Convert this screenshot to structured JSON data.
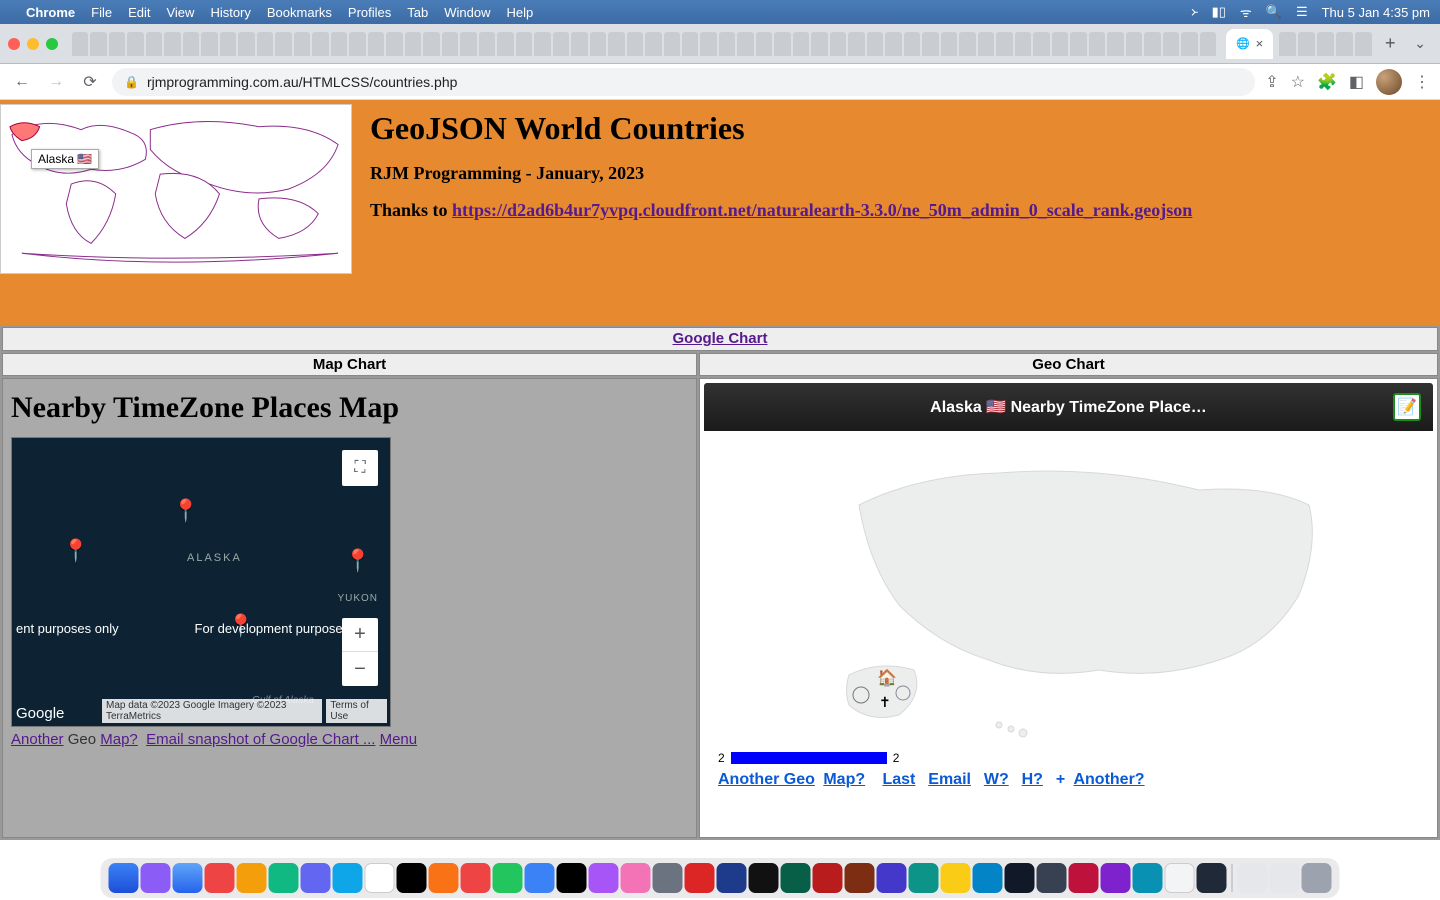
{
  "menubar": {
    "app": "Chrome",
    "items": [
      "File",
      "Edit",
      "View",
      "History",
      "Bookmarks",
      "Profiles",
      "Tab",
      "Window",
      "Help"
    ],
    "clock": "Thu 5 Jan  4:35 pm"
  },
  "browser": {
    "url": "rjmprogramming.com.au/HTMLCSS/countries.php",
    "active_tab_close": "×",
    "new_tab": "+"
  },
  "page": {
    "title": "GeoJSON World Countries",
    "subtitle": "RJM Programming - January, 2023",
    "thanks_prefix": "Thanks to ",
    "thanks_link": "https://d2ad6b4ur7yvpq.cloudfront.net/naturalearth-3.3.0/ne_50m_admin_0_scale_rank.geojson",
    "tooltip": "Alaska 🇺🇸"
  },
  "table": {
    "google_chart": "Google Chart",
    "map_chart": "Map Chart",
    "geo_chart": "Geo Chart"
  },
  "left": {
    "heading": "Nearby TimeZone Places Map",
    "alaska": "ALASKA",
    "yukon": "YUKON",
    "gulf": "Gulf of Alaska",
    "dev1": "ent purposes only",
    "dev2": "For development purposes o",
    "google": "Google",
    "attrib1": "Map data ©2023 Google Imagery ©2023 TerraMetrics",
    "attrib2": "Terms of Use",
    "links": {
      "another": "Another",
      "geo": "Geo",
      "mapq": "Map?",
      "email": "Email snapshot of Google Chart ...",
      "menu": "Menu"
    }
  },
  "right": {
    "header": "Alaska 🇺🇸 Nearby TimeZone Place…",
    "legend_low": "2",
    "legend_high": "2",
    "links": {
      "another_geo": "Another Geo",
      "mapq": "Map?",
      "last": "Last",
      "email": "Email",
      "w": "W?",
      "h": "H?",
      "plus": "+",
      "anotherq": "Another?"
    }
  },
  "chart_data": {
    "type": "map",
    "title": "Alaska 🇺🇸 Nearby TimeZone Places",
    "region": "US",
    "legend": {
      "min": 2,
      "max": 2,
      "color": "#0000ff"
    },
    "markers": [
      {
        "name": "Alaska",
        "value": 2
      }
    ]
  }
}
